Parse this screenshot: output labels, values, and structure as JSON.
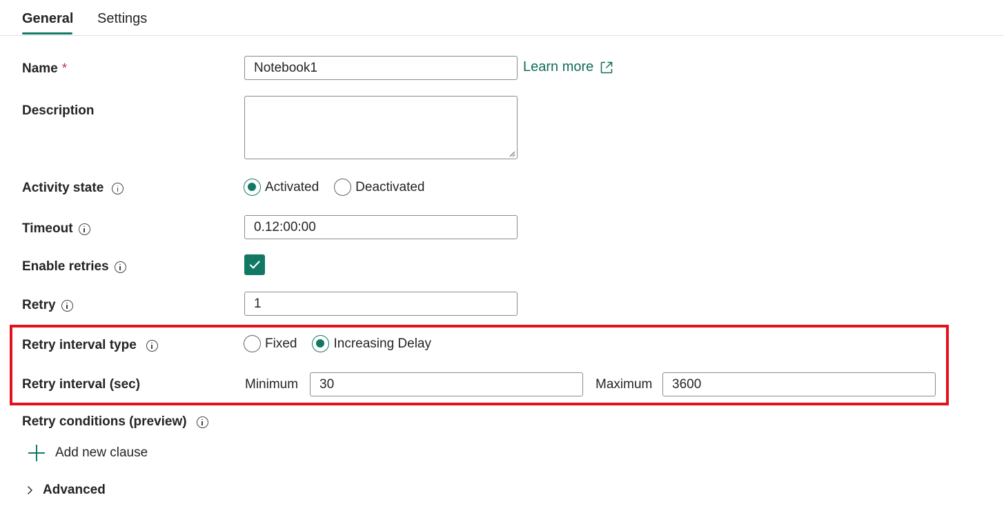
{
  "tabs": [
    {
      "label": "General",
      "active": true
    },
    {
      "label": "Settings",
      "active": false
    }
  ],
  "form": {
    "name": {
      "label": "Name",
      "required_mark": "*",
      "value": "Notebook1",
      "link_text": "Learn more"
    },
    "description": {
      "label": "Description",
      "value": ""
    },
    "activity_state": {
      "label": "Activity state",
      "options": [
        "Activated",
        "Deactivated"
      ],
      "selected": "Activated"
    },
    "timeout": {
      "label": "Timeout",
      "value": "0.12:00:00"
    },
    "enable_retries": {
      "label": "Enable retries",
      "checked": true
    },
    "retry": {
      "label": "Retry",
      "value": "1"
    },
    "retry_interval_type": {
      "label": "Retry interval type",
      "options": [
        "Fixed",
        "Increasing Delay"
      ],
      "selected": "Increasing Delay"
    },
    "retry_interval": {
      "label": "Retry interval (sec)",
      "minimum_label": "Minimum",
      "minimum_value": "30",
      "maximum_label": "Maximum",
      "maximum_value": "3600"
    },
    "retry_conditions": {
      "label": "Retry conditions (preview)",
      "add_clause_label": "Add new clause"
    },
    "advanced": {
      "label": "Advanced"
    }
  },
  "colors": {
    "accent": "#117865",
    "link": "#0f6c5b",
    "highlight": "#e3111c",
    "required": "#c4314b"
  }
}
